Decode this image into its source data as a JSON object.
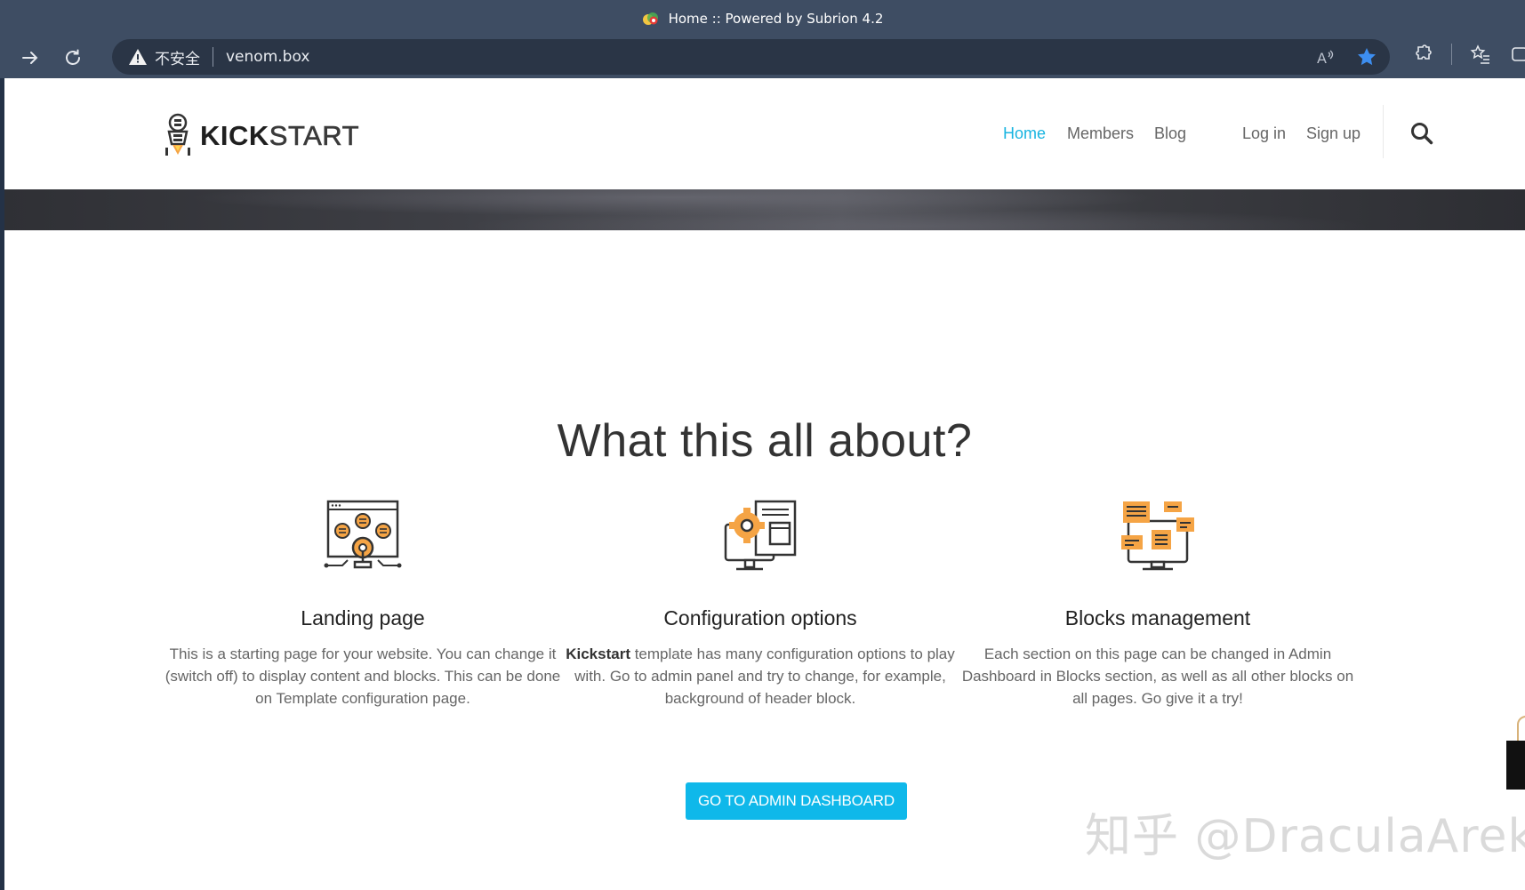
{
  "browser": {
    "tab_title": "Home :: Powered by Subrion 4.2",
    "security_label": "不安全",
    "url": "venom.box"
  },
  "site": {
    "logo_bold": "KICK",
    "logo_light": "START",
    "nav": [
      {
        "label": "Home",
        "active": true
      },
      {
        "label": "Members",
        "active": false
      },
      {
        "label": "Blog",
        "active": false
      },
      {
        "label": "Log in",
        "active": false
      },
      {
        "label": "Sign up",
        "active": false
      }
    ]
  },
  "section": {
    "title": "What this all about?"
  },
  "features": [
    {
      "title": "Landing page",
      "text": "This is a starting page for your website. You can change it (switch off) to display content and blocks. This can be done on Template configuration page.",
      "icon": "landing-page-icon"
    },
    {
      "title": "Configuration options",
      "bold_lead": "Kickstart",
      "text": " template has many configuration options to play with. Go to admin panel and try to change, for example, background of header block.",
      "icon": "configuration-options-icon"
    },
    {
      "title": "Blocks management",
      "text": "Each section on this page can be changed in Admin Dashboard in Blocks section, as well as all other blocks on all pages. Go give it a try!",
      "icon": "blocks-management-icon"
    }
  ],
  "cta": {
    "label": "GO TO ADMIN DASHBOARD"
  },
  "watermark": {
    "text": "知乎 @DraculaArek"
  },
  "colors": {
    "accent": "#18b4e0",
    "button": "#0fb8ea",
    "chrome": "#3e4d63",
    "icon_orange": "#f5a445"
  }
}
